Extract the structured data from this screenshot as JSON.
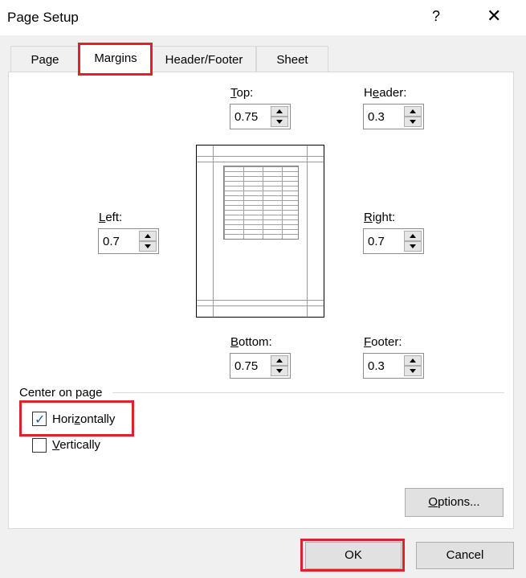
{
  "window": {
    "title": "Page Setup",
    "help": "?",
    "close": "✕"
  },
  "tabs": [
    {
      "label": "Page"
    },
    {
      "label": "Margins"
    },
    {
      "label": "Header/Footer"
    },
    {
      "label": "Sheet"
    }
  ],
  "margins": {
    "top": {
      "label": "Top:",
      "value": "0.75"
    },
    "header": {
      "label": "Header:",
      "value": "0.3"
    },
    "left": {
      "label": "Left:",
      "value": "0.7"
    },
    "right": {
      "label": "Right:",
      "value": "0.7"
    },
    "bottom": {
      "label": "Bottom:",
      "value": "0.75"
    },
    "footer": {
      "label": "Footer:",
      "value": "0.3"
    }
  },
  "center": {
    "group_label": "Center on page",
    "horizontally": {
      "label": "Horizontally",
      "checked": true
    },
    "vertically": {
      "label": "Vertically",
      "checked": false
    }
  },
  "buttons": {
    "options": "Options...",
    "ok": "OK",
    "cancel": "Cancel"
  },
  "colors": {
    "highlight": "#e0202a",
    "check": "#1a5fb4"
  }
}
